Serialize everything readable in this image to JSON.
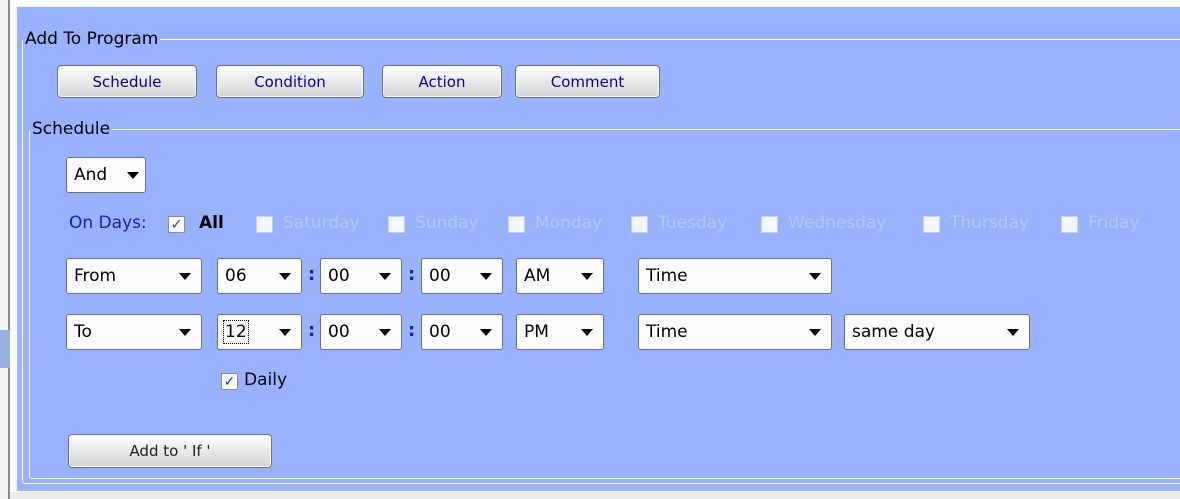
{
  "add_to_program": {
    "legend": "Add To Program",
    "buttons": {
      "schedule": "Schedule",
      "condition": "Condition",
      "action": "Action",
      "comment": "Comment"
    }
  },
  "schedule": {
    "legend": "Schedule",
    "logic_operator": "And",
    "on_days": {
      "label": "On Days:",
      "all": {
        "label": "All",
        "checked": true
      },
      "days": [
        {
          "label": "Saturday",
          "checked": false
        },
        {
          "label": "Sunday",
          "checked": false
        },
        {
          "label": "Monday",
          "checked": false
        },
        {
          "label": "Tuesday",
          "checked": false
        },
        {
          "label": "Wednesday",
          "checked": false
        },
        {
          "label": "Thursday",
          "checked": false
        },
        {
          "label": "Friday",
          "checked": false
        }
      ]
    },
    "from_row": {
      "mode": "From",
      "hour": "06",
      "minute": "00",
      "second": "00",
      "ampm": "AM",
      "type": "Time"
    },
    "to_row": {
      "mode": "To",
      "hour": "12",
      "minute": "00",
      "second": "00",
      "ampm": "PM",
      "type": "Time",
      "day_relation": "same day"
    },
    "time_separator": ":",
    "daily": {
      "label": "Daily",
      "checked": true
    },
    "add_button": "Add to ' If '"
  },
  "colors": {
    "panel_background": "#98b2ff",
    "label_blue": "#1a1ab0",
    "button_text": "#0000a8",
    "disabled_text": "#b8c8f8"
  }
}
